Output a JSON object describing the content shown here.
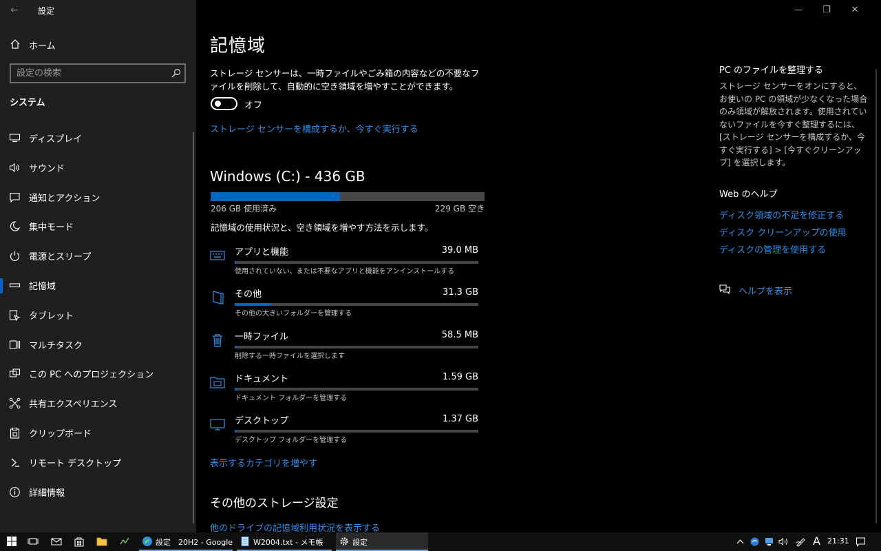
{
  "window": {
    "title": "設定",
    "back": "←",
    "minimize": "—",
    "restore": "❐",
    "close": "✕"
  },
  "sidebar": {
    "home": "ホーム",
    "search_placeholder": "設定の検索",
    "section": "システム",
    "items": [
      {
        "label": "ディスプレイ",
        "icon": "display-icon"
      },
      {
        "label": "サウンド",
        "icon": "speaker-icon"
      },
      {
        "label": "通知とアクション",
        "icon": "notification-icon"
      },
      {
        "label": "集中モード",
        "icon": "moon-icon"
      },
      {
        "label": "電源とスリープ",
        "icon": "power-icon"
      },
      {
        "label": "記憶域",
        "icon": "storage-icon",
        "selected": true
      },
      {
        "label": "タブレット",
        "icon": "tablet-icon"
      },
      {
        "label": "マルチタスク",
        "icon": "multitask-icon"
      },
      {
        "label": "この PC へのプロジェクション",
        "icon": "projection-icon"
      },
      {
        "label": "共有エクスペリエンス",
        "icon": "share-icon"
      },
      {
        "label": "クリップボード",
        "icon": "clipboard-icon"
      },
      {
        "label": "リモート デスクトップ",
        "icon": "remote-desktop-icon"
      },
      {
        "label": "詳細情報",
        "icon": "info-icon"
      }
    ]
  },
  "main": {
    "title": "記憶域",
    "description": "ストレージ センサーは、一時ファイルやごみ箱の内容などの不要なファイルを削除して、自動的に空き領域を増やすことができます。",
    "toggle_state": "オフ",
    "toggle_on": false,
    "configure_link": "ストレージ センサーを構成するか、今すぐ実行する",
    "drive": {
      "title": "Windows (C:) - 436 GB",
      "used": "206 GB 使用済み",
      "free": "229 GB 空き",
      "used_fraction": 0.472
    },
    "usage_desc": "記憶域の使用状況と、空き領域を増やす方法を示します。",
    "categories": [
      {
        "name": "アプリと機能",
        "size": "39.0 MB",
        "desc": "使用されていない、または不要なアプリと機能をアンインストールする",
        "fraction": 0.002,
        "icon": "apps-icon"
      },
      {
        "name": "その他",
        "size": "31.3 GB",
        "desc": "その他の大きいフォルダーを管理する",
        "fraction": 0.15,
        "icon": "other-icon"
      },
      {
        "name": "一時ファイル",
        "size": "58.5 MB",
        "desc": "削除する一時ファイルを選択します",
        "fraction": 0.003,
        "icon": "trash-icon"
      },
      {
        "name": "ドキュメント",
        "size": "1.59 GB",
        "desc": "ドキュメント フォルダーを管理する",
        "fraction": 0.008,
        "icon": "documents-icon"
      },
      {
        "name": "デスクトップ",
        "size": "1.37 GB",
        "desc": "デスクトップ フォルダーを管理する",
        "fraction": 0.007,
        "icon": "desktop-icon"
      }
    ],
    "more_categories": "表示するカテゴリを増やす",
    "other_storage_title": "その他のストレージ設定",
    "other_drives_link": "他のドライブの記憶域利用状況を表示する"
  },
  "right_panel": {
    "title1": "PC のファイルを整理する",
    "desc": "ストレージ センサーをオンにすると、お使いの PC の領域が少なくなった場合のみ領域が解放されます。使用されていないファイルを今すぐ整理するには、[ストレージ センサーを構成するか、今すぐ実行する] > [今すぐクリーンアップ] を選択します。",
    "title2": "Web のヘルプ",
    "links": [
      "ディスク領域の不足を修正する",
      "ディスク クリーンアップの使用",
      "ディスクの管理を使用する"
    ],
    "help": "ヘルプを表示"
  },
  "taskbar": {
    "tasks": [
      {
        "label": "設定　20H2 - Google ...",
        "icon": "edge-icon"
      },
      {
        "label": "W2004.txt - メモ帳",
        "icon": "notepad-icon"
      },
      {
        "label": "設定",
        "icon": "gear-icon"
      }
    ],
    "ime": "A",
    "time": "21:31"
  },
  "colors": {
    "accent": "#0067c0",
    "link": "#2e8fe8",
    "sidebar_bg": "#1f1f1f",
    "main_bg": "#000000"
  }
}
